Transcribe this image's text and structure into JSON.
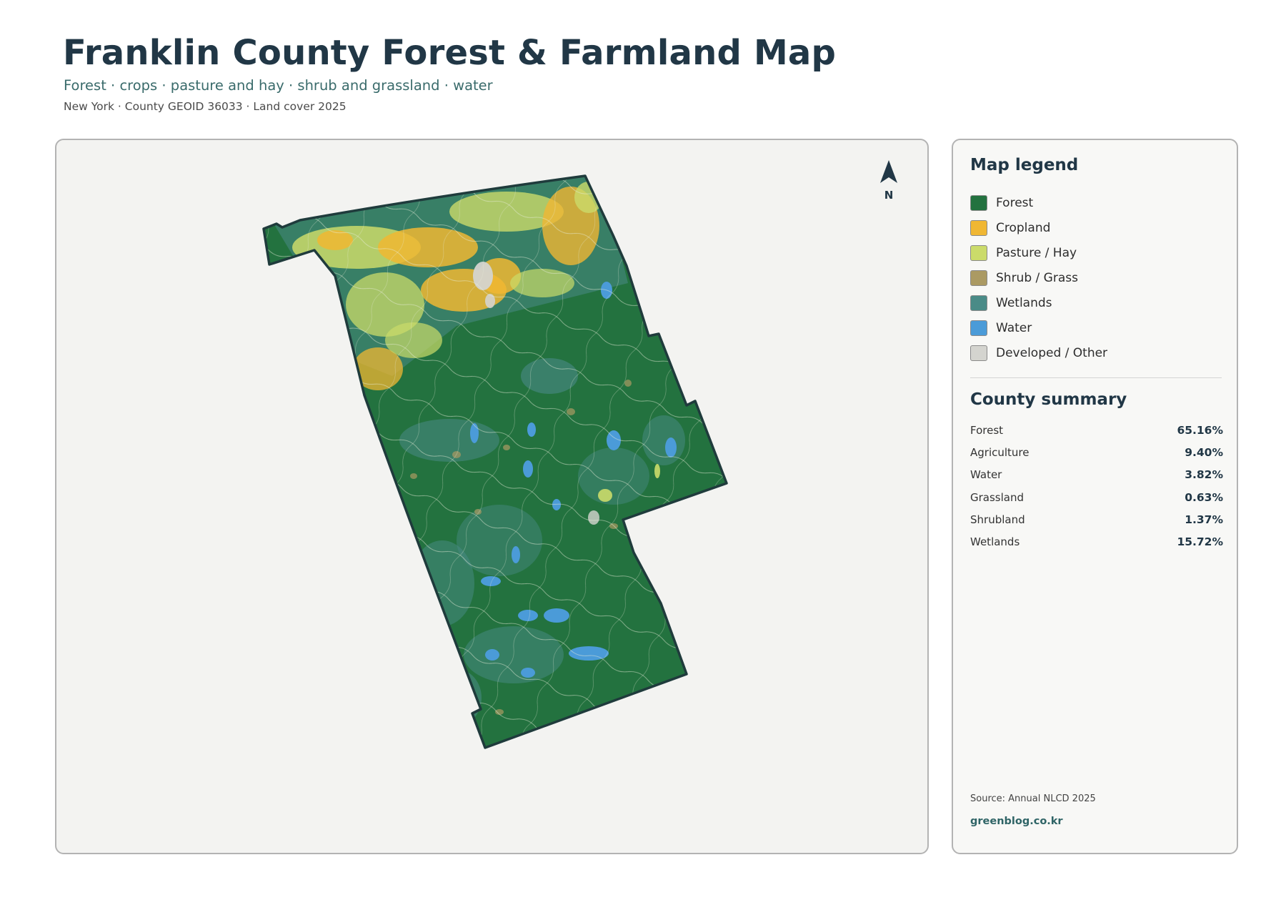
{
  "header": {
    "title": "Franklin County Forest & Farmland Map",
    "subtitle": "Forest · crops · pasture and hay · shrub and grassland · water",
    "meta": "New York · County GEOID 36033 · Land cover 2025"
  },
  "map": {
    "north_label": "N",
    "colors": {
      "forest": "#23723f",
      "cropland": "#f0b733",
      "pasture": "#cbdb6a",
      "shrub": "#ab9a63",
      "wetlands": "#4a8b87",
      "water": "#4b9bd8",
      "developed": "#d4d4cf",
      "outline": "#1f3b3c"
    }
  },
  "legend": {
    "title": "Map legend",
    "items": [
      {
        "label": "Forest",
        "color": "#23723f"
      },
      {
        "label": "Cropland",
        "color": "#f0b733"
      },
      {
        "label": "Pasture / Hay",
        "color": "#cbdb6a"
      },
      {
        "label": "Shrub / Grass",
        "color": "#ab9a63"
      },
      {
        "label": "Wetlands",
        "color": "#4a8b87"
      },
      {
        "label": "Water",
        "color": "#4b9bd8"
      },
      {
        "label": "Developed / Other",
        "color": "#d4d4cf"
      }
    ]
  },
  "summary": {
    "title": "County summary",
    "rows": [
      {
        "label": "Forest",
        "value": "65.16%"
      },
      {
        "label": "Agriculture",
        "value": "9.40%"
      },
      {
        "label": "Water",
        "value": "3.82%"
      },
      {
        "label": "Grassland",
        "value": "0.63%"
      },
      {
        "label": "Shrubland",
        "value": "1.37%"
      },
      {
        "label": "Wetlands",
        "value": "15.72%"
      }
    ]
  },
  "footer": {
    "source": "Source: Annual NLCD 2025",
    "site": "greenblog.co.kr"
  }
}
